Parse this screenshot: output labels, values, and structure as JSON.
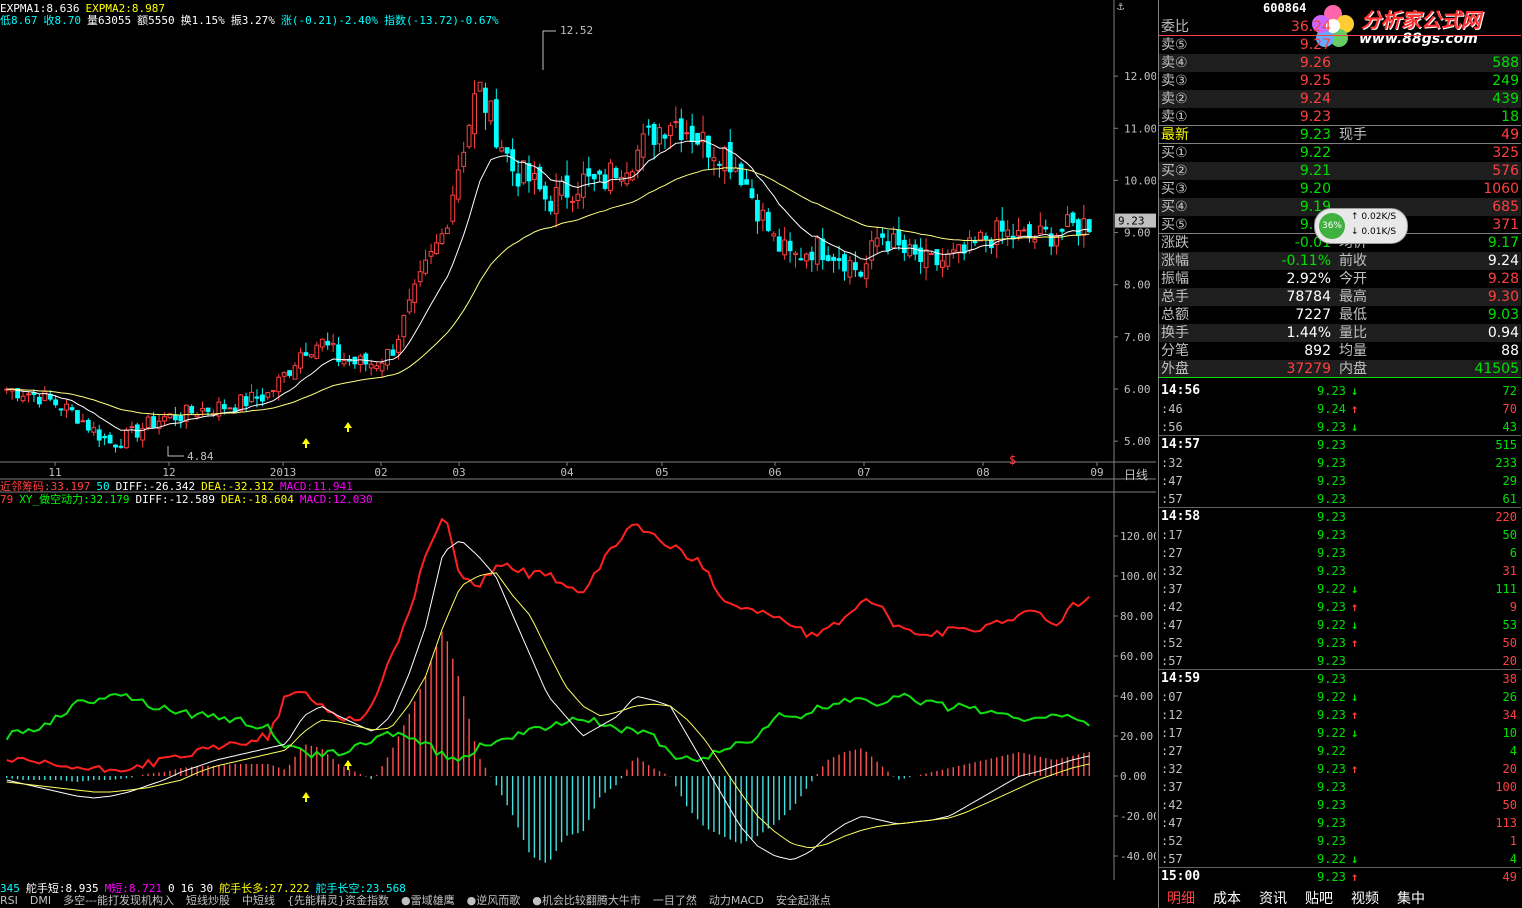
{
  "top_info": {
    "line1": [
      {
        "text": "EXPMA1:8.636",
        "color": "#ffffff"
      },
      {
        "text": "EXPMA2:8.987",
        "color": "#ffff00"
      }
    ],
    "line2": [
      {
        "text": "低8.67",
        "color": "#00ffff"
      },
      {
        "text": "收8.70",
        "color": "#00ffff"
      },
      {
        "text": "量63055",
        "color": "#ffffff"
      },
      {
        "text": "额5550",
        "color": "#ffffff"
      },
      {
        "text": "换1.15%",
        "color": "#ffffff"
      },
      {
        "text": "振3.27%",
        "color": "#ffffff"
      },
      {
        "text": "涨(-0.21)-2.40%",
        "color": "#00ffff"
      },
      {
        "text": "指数(-13.72)-0.67%",
        "color": "#00ffff"
      }
    ]
  },
  "indicator_info": {
    "line1": [
      {
        "text": "近邻筹码:33.197",
        "color": "#ff4040"
      },
      {
        "text": "50",
        "color": "#00ffff"
      },
      {
        "text": "DIFF:-26.342",
        "color": "#ffffff"
      },
      {
        "text": "DEA:-32.312",
        "color": "#ffff00"
      },
      {
        "text": "MACD:11.941",
        "color": "#ff00ff"
      }
    ],
    "line2": [
      {
        "text": "79",
        "color": "#ff4040"
      },
      {
        "text": "XY_做空动力:32.179",
        "color": "#00ff00"
      },
      {
        "text": "DIFF:-12.589",
        "color": "#ffffff"
      },
      {
        "text": "DEA:-18.604",
        "color": "#ffff00"
      },
      {
        "text": "MACD:12.030",
        "color": "#ff00ff"
      }
    ]
  },
  "bottom_info": [
    {
      "text": "345",
      "color": "#00ffff"
    },
    {
      "text": "舵手短:8.935",
      "color": "#ffffff"
    },
    {
      "text": "M短:8.721",
      "color": "#ff00ff"
    },
    {
      "text": "0",
      "color": "#ffffff"
    },
    {
      "text": "16",
      "color": "#ffffff"
    },
    {
      "text": "30",
      "color": "#ffffff"
    },
    {
      "text": "舵手长多:27.222",
      "color": "#ffff00"
    },
    {
      "text": "舵手长空:23.568",
      "color": "#00ffff"
    }
  ],
  "bottom_tabs": [
    "RSI",
    "DMI",
    "多空---能打发现机构入",
    "短线炒股",
    "中短线",
    "{先能精灵}资金指数",
    "●雷域雄鹰",
    "●逆风而歌",
    "●机会比较翻腾大牛市",
    "一目了然",
    "动力MACD",
    "安全起涨点"
  ],
  "period_label": "日线",
  "right_panel": {
    "stock_code": "600864",
    "logo": {
      "name": "分析家公式网",
      "url": "www.88gs.com"
    },
    "quote_top": [
      {
        "label": "委比",
        "value": "36.24",
        "vcolor": "#ff4040",
        "right": ""
      }
    ],
    "sells": [
      {
        "label": "卖⑤",
        "price": "9.27",
        "vol": ""
      },
      {
        "label": "卖④",
        "price": "9.26",
        "vol": "588"
      },
      {
        "label": "卖③",
        "price": "9.25",
        "vol": "249"
      },
      {
        "label": "卖②",
        "price": "9.24",
        "vol": "439"
      },
      {
        "label": "卖①",
        "price": "9.23",
        "vol": "18"
      }
    ],
    "latest": {
      "label": "最新",
      "price": "9.23",
      "mid": "现手",
      "vol": "49"
    },
    "buys": [
      {
        "label": "买①",
        "price": "9.22",
        "vol": "325"
      },
      {
        "label": "买②",
        "price": "9.21",
        "vol": "576"
      },
      {
        "label": "买③",
        "price": "9.20",
        "vol": "1060"
      },
      {
        "label": "买④",
        "price": "9.19",
        "vol": "685"
      },
      {
        "label": "买⑤",
        "price": "9.18",
        "vol": "371"
      }
    ],
    "stats": [
      {
        "l1": "涨跌",
        "v1": "-0.01",
        "c1": "#00e000",
        "l2": "均价",
        "v2": "9.17",
        "c2": "#00e000"
      },
      {
        "l1": "涨幅",
        "v1": "-0.11%",
        "c1": "#00e000",
        "l2": "前收",
        "v2": "9.24",
        "c2": "#ffffff"
      },
      {
        "l1": "振幅",
        "v1": "2.92%",
        "c1": "#ffffff",
        "l2": "今开",
        "v2": "9.28",
        "c2": "#ff4040"
      },
      {
        "l1": "总手",
        "v1": "78784",
        "c1": "#ffffff",
        "l2": "最高",
        "v2": "9.30",
        "c2": "#ff4040"
      },
      {
        "l1": "总额",
        "v1": "7227",
        "c1": "#ffffff",
        "l2": "最低",
        "v2": "9.03",
        "c2": "#00e000"
      },
      {
        "l1": "换手",
        "v1": "1.44%",
        "c1": "#ffffff",
        "l2": "量比",
        "v2": "0.94",
        "c2": "#ffffff"
      },
      {
        "l1": "分笔",
        "v1": "892",
        "c1": "#ffffff",
        "l2": "均量",
        "v2": "88",
        "c2": "#ffffff"
      },
      {
        "l1": "外盘",
        "v1": "37279",
        "c1": "#ff4040",
        "l2": "内盘",
        "v2": "41505",
        "c2": "#00e000"
      }
    ],
    "ticks": [
      {
        "t": "14:56",
        "major": true,
        "p": "9.23",
        "a": "down",
        "v": "72",
        "vc": "#00e000"
      },
      {
        "t": ":46",
        "major": false,
        "p": "9.24",
        "a": "up",
        "v": "70",
        "vc": "#ff4040"
      },
      {
        "t": ":56",
        "major": false,
        "p": "9.23",
        "a": "down",
        "v": "43",
        "vc": "#00e000"
      },
      {
        "t": "14:57",
        "major": true,
        "p": "9.23",
        "a": "",
        "v": "515",
        "vc": "#00e000"
      },
      {
        "t": ":32",
        "major": false,
        "p": "9.23",
        "a": "",
        "v": "233",
        "vc": "#00e000"
      },
      {
        "t": ":47",
        "major": false,
        "p": "9.23",
        "a": "",
        "v": "29",
        "vc": "#00e000"
      },
      {
        "t": ":57",
        "major": false,
        "p": "9.23",
        "a": "",
        "v": "61",
        "vc": "#00e000"
      },
      {
        "t": "14:58",
        "major": true,
        "p": "9.23",
        "a": "",
        "v": "220",
        "vc": "#ff4040"
      },
      {
        "t": ":17",
        "major": false,
        "p": "9.23",
        "a": "",
        "v": "50",
        "vc": "#00e000"
      },
      {
        "t": ":27",
        "major": false,
        "p": "9.23",
        "a": "",
        "v": "6",
        "vc": "#00e000"
      },
      {
        "t": ":32",
        "major": false,
        "p": "9.23",
        "a": "",
        "v": "31",
        "vc": "#ff4040"
      },
      {
        "t": ":37",
        "major": false,
        "p": "9.22",
        "a": "down",
        "v": "111",
        "vc": "#00e000"
      },
      {
        "t": ":42",
        "major": false,
        "p": "9.23",
        "a": "up",
        "v": "9",
        "vc": "#ff4040"
      },
      {
        "t": ":47",
        "major": false,
        "p": "9.22",
        "a": "down",
        "v": "53",
        "vc": "#00e000"
      },
      {
        "t": ":52",
        "major": false,
        "p": "9.23",
        "a": "up",
        "v": "50",
        "vc": "#ff4040"
      },
      {
        "t": ":57",
        "major": false,
        "p": "9.23",
        "a": "",
        "v": "20",
        "vc": "#ff4040"
      },
      {
        "t": "14:59",
        "major": true,
        "p": "9.23",
        "a": "",
        "v": "38",
        "vc": "#ff4040"
      },
      {
        "t": ":07",
        "major": false,
        "p": "9.22",
        "a": "down",
        "v": "26",
        "vc": "#00e000"
      },
      {
        "t": ":12",
        "major": false,
        "p": "9.23",
        "a": "up",
        "v": "34",
        "vc": "#ff4040"
      },
      {
        "t": ":17",
        "major": false,
        "p": "9.22",
        "a": "down",
        "v": "10",
        "vc": "#00e000"
      },
      {
        "t": ":27",
        "major": false,
        "p": "9.22",
        "a": "",
        "v": "4",
        "vc": "#00e000"
      },
      {
        "t": ":32",
        "major": false,
        "p": "9.23",
        "a": "up",
        "v": "20",
        "vc": "#ff4040"
      },
      {
        "t": ":37",
        "major": false,
        "p": "9.23",
        "a": "",
        "v": "100",
        "vc": "#ff4040"
      },
      {
        "t": ":42",
        "major": false,
        "p": "9.23",
        "a": "",
        "v": "50",
        "vc": "#ff4040"
      },
      {
        "t": ":47",
        "major": false,
        "p": "9.23",
        "a": "",
        "v": "113",
        "vc": "#ff4040"
      },
      {
        "t": ":52",
        "major": false,
        "p": "9.23",
        "a": "",
        "v": "1",
        "vc": "#ff4040"
      },
      {
        "t": ":57",
        "major": false,
        "p": "9.22",
        "a": "down",
        "v": "4",
        "vc": "#00e000"
      },
      {
        "t": "15:00",
        "major": true,
        "p": "9.23",
        "a": "up",
        "v": "49",
        "vc": "#ff4040"
      }
    ],
    "tabs": [
      "明细",
      "成本",
      "资讯",
      "贴吧",
      "视频",
      "集中"
    ],
    "speed": {
      "pct": "36%",
      "up": "0.02K/S",
      "down": "0.01K/S"
    }
  },
  "chart_data": [
    {
      "type": "candlestick",
      "title": "",
      "ylim": [
        4.6,
        13.0
      ],
      "y_ticks": [
        "5.00",
        "6.00",
        "7.00",
        "8.00",
        "9.00",
        "10.00",
        "11.00",
        "12.00"
      ],
      "x_ticks": [
        "11",
        "12",
        "2013",
        "02",
        "03",
        "04",
        "05",
        "06",
        "07",
        "08",
        "09"
      ],
      "annotations": {
        "high": "12.52",
        "low": "4.84",
        "last": "9.23"
      },
      "close_path": [
        6.0,
        5.95,
        5.85,
        5.7,
        5.5,
        5.2,
        4.95,
        5.1,
        5.3,
        5.45,
        5.5,
        5.6,
        5.65,
        5.7,
        5.8,
        5.9,
        6.3,
        6.8,
        6.9,
        6.6,
        6.5,
        6.5,
        6.7,
        7.5,
        8.3,
        9.0,
        10.5,
        11.8,
        11.0,
        10.2,
        10.0,
        9.6,
        9.8,
        10.0,
        9.9,
        10.3,
        10.5,
        10.9,
        11.2,
        11.0,
        10.7,
        10.6,
        10.2,
        9.5,
        8.8,
        8.5,
        8.7,
        8.7,
        8.5,
        8.2,
        9.0,
        8.7,
        8.5,
        8.4,
        8.5,
        8.6,
        8.9,
        9.0,
        8.9,
        8.9,
        9.0,
        9.1,
        9.2
      ]
    },
    {
      "type": "indicator",
      "ylim": [
        -48,
        136
      ],
      "y_ticks": [
        "120.00",
        "100.00",
        "80.00",
        "60.00",
        "40.00",
        "20.00",
        "0.00",
        "-20.00",
        "-40.00"
      ],
      "series": [
        {
          "name": "近邻筹码",
          "color": "#ff2020",
          "values": [
            8,
            7,
            6,
            5,
            4,
            3,
            3,
            4,
            6,
            8,
            10,
            12,
            14,
            16,
            18,
            20,
            40,
            42,
            35,
            30,
            28,
            35,
            60,
            80,
            110,
            132,
            100,
            95,
            105,
            105,
            100,
            102,
            95,
            90,
            105,
            118,
            126,
            120,
            115,
            110,
            105,
            88,
            85,
            82,
            80,
            75,
            70,
            72,
            80,
            88,
            85,
            74,
            72,
            70,
            73,
            72,
            75,
            78,
            80,
            82,
            75,
            85,
            88
          ]
        },
        {
          "name": "XY_做空动力",
          "color": "#10e010",
          "values": [
            20,
            22,
            25,
            30,
            36,
            38,
            42,
            40,
            36,
            34,
            32,
            30,
            30,
            28,
            26,
            24,
            14,
            12,
            10,
            12,
            14,
            18,
            22,
            20,
            16,
            10,
            8,
            14,
            18,
            20,
            22,
            25,
            28,
            30,
            26,
            24,
            22,
            20,
            10,
            8,
            10,
            12,
            16,
            20,
            30,
            28,
            32,
            35,
            38,
            40,
            35,
            42,
            38,
            36,
            34,
            36,
            32,
            30,
            28,
            30,
            32,
            28,
            26
          ]
        },
        {
          "name": "DIFF",
          "color": "#ffffff",
          "values": [
            -2,
            -4,
            -6,
            -8,
            -10,
            -11,
            -10,
            -8,
            -5,
            -2,
            2,
            5,
            8,
            10,
            12,
            14,
            16,
            30,
            35,
            30,
            26,
            22,
            30,
            50,
            75,
            112,
            118,
            110,
            100,
            80,
            60,
            40,
            30,
            20,
            25,
            30,
            40,
            38,
            35,
            20,
            5,
            -10,
            -25,
            -35,
            -40,
            -42,
            -38,
            -30,
            -24,
            -20,
            -22,
            -24,
            -23,
            -22,
            -20,
            -15,
            -10,
            -5,
            0,
            2,
            5,
            8,
            10
          ]
        },
        {
          "name": "DEA",
          "color": "#ffff60",
          "values": [
            -3,
            -4,
            -5,
            -6,
            -7,
            -8,
            -8,
            -7,
            -6,
            -4,
            -2,
            2,
            5,
            7,
            9,
            11,
            13,
            22,
            28,
            27,
            25,
            23,
            24,
            35,
            50,
            75,
            95,
            100,
            102,
            90,
            80,
            62,
            45,
            35,
            30,
            32,
            35,
            36,
            35,
            28,
            18,
            5,
            -8,
            -20,
            -28,
            -34,
            -36,
            -34,
            -30,
            -27,
            -25,
            -24,
            -23,
            -22,
            -21,
            -18,
            -14,
            -10,
            -6,
            -2,
            1,
            4,
            6
          ]
        },
        {
          "name": "MACD",
          "color": "#ff4040",
          "values": [
            -1,
            -2,
            -2,
            -2,
            -3,
            -2,
            -2,
            -1,
            1,
            2,
            4,
            5,
            5,
            6,
            6,
            6,
            3,
            16,
            14,
            6,
            2,
            -2,
            12,
            30,
            50,
            74,
            46,
            10,
            -4,
            -20,
            -40,
            -44,
            -30,
            -28,
            -10,
            -4,
            10,
            4,
            0,
            -16,
            -26,
            -30,
            -34,
            -30,
            -24,
            -16,
            -4,
            8,
            12,
            14,
            6,
            -2,
            0,
            2,
            4,
            6,
            8,
            10,
            12,
            10,
            8,
            10,
            12
          ]
        }
      ]
    }
  ]
}
